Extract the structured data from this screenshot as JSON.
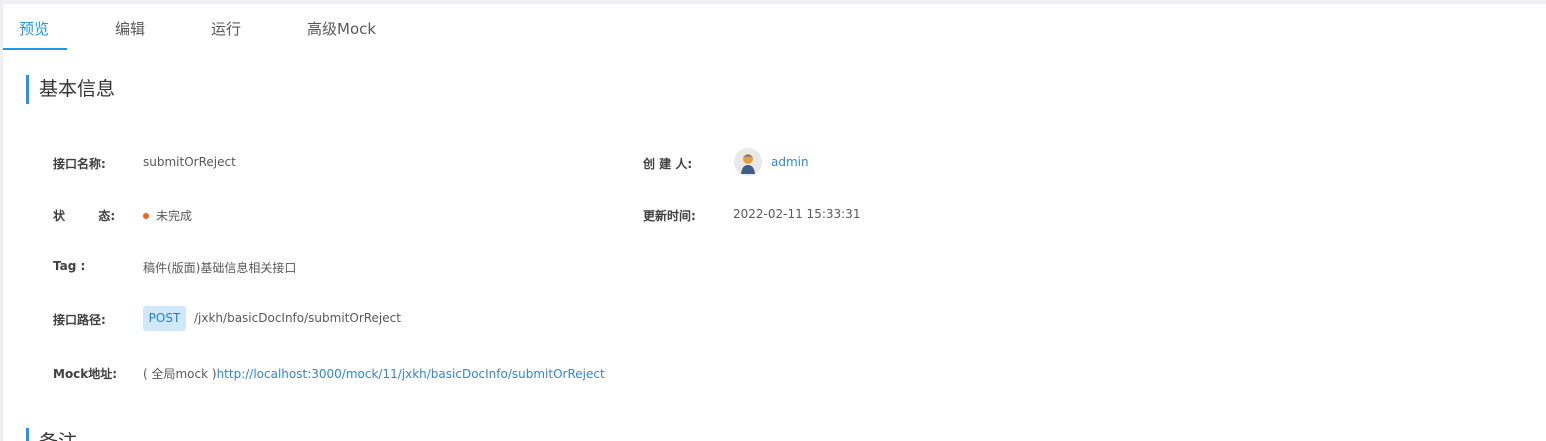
{
  "tabs": [
    {
      "label": "预览",
      "active": true
    },
    {
      "label": "编辑"
    },
    {
      "label": "运行"
    },
    {
      "label": "高级Mock"
    }
  ],
  "basic_info": {
    "title": "基本信息",
    "name_label": "接口名称:",
    "name_value": "submitOrReject",
    "creator_label": "创 建 人:",
    "creator_name": "admin",
    "status_label": "状        态:",
    "status_value": "未完成",
    "status_color": "#f5641e",
    "update_label": "更新时间:",
    "update_value": "2022-02-11 15:33:31",
    "tag_label": "Tag :",
    "tag_value": "稿件(版面)基础信息相关接口",
    "path_label": "接口路径:",
    "method": "POST",
    "path_value": "/jxkh/basicDocInfo/submitOrReject",
    "mock_label": "Mock地址:",
    "mock_prefix": "( 全局mock )",
    "mock_url": "http://localhost:3000/mock/11/jxkh/basicDocInfo/submitOrReject"
  },
  "remark": {
    "title": "备注"
  },
  "colors": {
    "accent": "#2395f1",
    "link": "#2e86d6",
    "method_bg": "#cfe8fc"
  }
}
